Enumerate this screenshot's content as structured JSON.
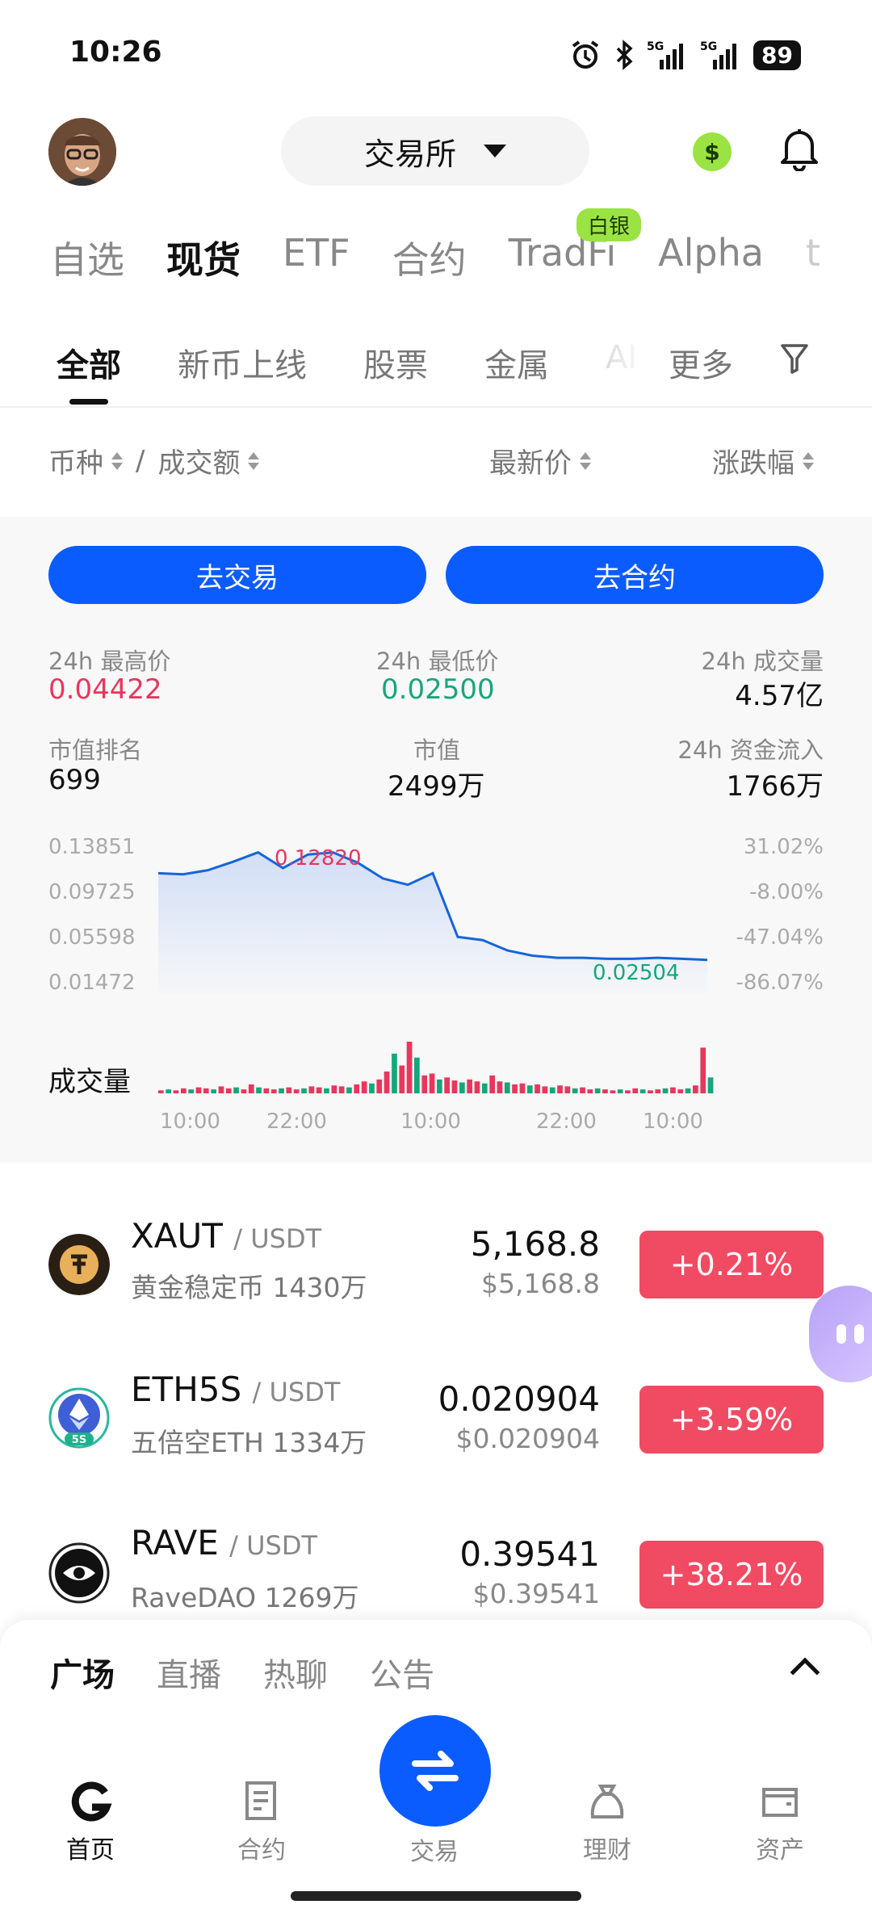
{
  "status_bar": {
    "time": "10:26",
    "battery": "89",
    "network": "5G"
  },
  "header": {
    "exchange_label": "交易所",
    "coin_symbol": "$"
  },
  "main_tabs": [
    "自选",
    "现货",
    "ETF",
    "合约",
    "TradFi",
    "Alpha",
    "t"
  ],
  "main_tab_badge": "白银",
  "sub_tabs": [
    "全部",
    "新币上线",
    "股票",
    "金属",
    "AI",
    "更多"
  ],
  "columns": {
    "pair": "币种",
    "sep": "/",
    "volume": "成交额",
    "price": "最新价",
    "change": "涨跌幅"
  },
  "detail": {
    "buttons": {
      "trade": "去交易",
      "contract": "去合约"
    },
    "stats": [
      {
        "label": "24h 最高价",
        "value": "0.04422",
        "tone": "red"
      },
      {
        "label": "24h 最低价",
        "value": "0.02500",
        "tone": "green"
      },
      {
        "label": "24h 成交量",
        "value": "4.57亿",
        "tone": "plain"
      },
      {
        "label": "市值排名",
        "value": "699",
        "tone": "plain"
      },
      {
        "label": "市值",
        "value": "2499万",
        "tone": "plain"
      },
      {
        "label": "24h 资金流入",
        "value": "1766万",
        "tone": "plain"
      }
    ],
    "price_axis": [
      "0.13851",
      "0.09725",
      "0.05598",
      "0.01472"
    ],
    "pct_axis": [
      "31.02%",
      "-8.00%",
      "-47.04%",
      "-86.07%"
    ],
    "high_marker": "0.12820",
    "low_marker": "0.02504",
    "volume_label": "成交量",
    "time_axis": [
      "10:00",
      "22:00",
      "10:00",
      "22:00",
      "10:00"
    ],
    "colors": {
      "line": "#1565d8",
      "up": "#e8365d",
      "down": "#17a67a"
    }
  },
  "chart_data": {
    "type": "line",
    "title": "",
    "x": [
      "10:00",
      "22:00",
      "10:00",
      "22:00",
      "10:00"
    ],
    "series": [
      {
        "values": [
          0.108,
          0.107,
          0.111,
          0.119,
          0.128,
          0.113,
          0.126,
          0.128,
          0.118,
          0.103,
          0.097,
          0.108,
          0.047,
          0.044,
          0.034,
          0.029,
          0.027,
          0.027,
          0.026,
          0.026,
          0.027,
          0.026,
          0.025
        ]
      }
    ],
    "ylim": [
      0.01472,
      0.13851
    ],
    "y2_ticks": [
      "31.02%",
      "-8.00%",
      "-47.04%",
      "-86.07%"
    ],
    "annotations": {
      "max": "0.12820",
      "min": "0.02504"
    },
    "volume": [
      3,
      4,
      3,
      5,
      4,
      6,
      5,
      4,
      7,
      5,
      6,
      4,
      9,
      6,
      5,
      4,
      5,
      6,
      4,
      5,
      7,
      6,
      5,
      8,
      7,
      6,
      9,
      12,
      10,
      14,
      22,
      40,
      28,
      52,
      36,
      18,
      20,
      14,
      16,
      13,
      11,
      14,
      12,
      10,
      18,
      12,
      11,
      9,
      10,
      8,
      9,
      7,
      6,
      8,
      7,
      5,
      6,
      4,
      5,
      4,
      3,
      4,
      3,
      5,
      4,
      3,
      4,
      5,
      6,
      4,
      5,
      8,
      46,
      16
    ]
  },
  "list": [
    {
      "base": "XAUT",
      "quote": "/ USDT",
      "name": "黄金稳定币",
      "vol": "1430万",
      "price": "5,168.8",
      "usd": "$5,168.8",
      "change": "+0.21%"
    },
    {
      "base": "ETH5S",
      "quote": "/ USDT",
      "name": "五倍空ETH",
      "vol": "1334万",
      "price": "0.020904",
      "usd": "$0.020904",
      "change": "+3.59%"
    },
    {
      "base": "RAVE",
      "quote": "/ USDT",
      "name": "RaveDAO",
      "vol": "1269万",
      "price": "0.39541",
      "usd": "$0.39541",
      "change": "+38.21%"
    }
  ],
  "feed_tabs": [
    "广场",
    "直播",
    "热聊",
    "公告"
  ],
  "bottom_nav": [
    "首页",
    "合约",
    "交易",
    "理财",
    "资产"
  ]
}
